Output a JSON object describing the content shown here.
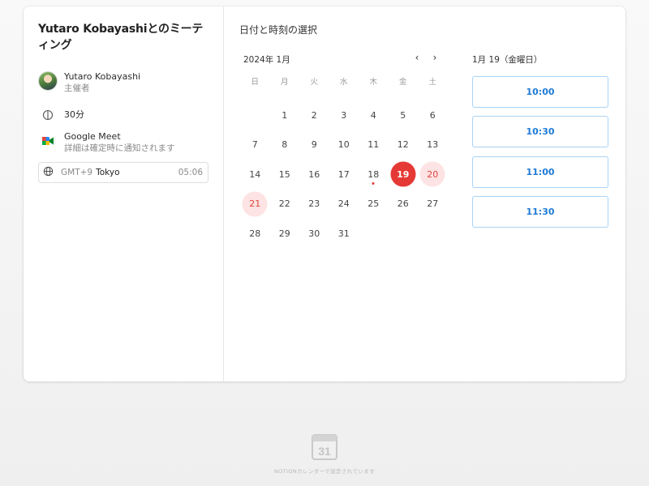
{
  "meeting": {
    "title": "Yutaro Kobayashiとのミーティング",
    "host_name": "Yutaro Kobayashi",
    "host_role": "主催者",
    "duration": "30分",
    "conference_name": "Google Meet",
    "conference_note": "詳細は確定時に通知されます",
    "timezone_offset": "GMT+9",
    "timezone_city": "Tokyo",
    "current_time": "05:06"
  },
  "calendar": {
    "section_title": "日付と時刻の選択",
    "month_label": "2024年 1月",
    "prev_label": "‹",
    "next_label": "›",
    "weekdays": [
      "日",
      "月",
      "火",
      "水",
      "木",
      "金",
      "土"
    ],
    "days": [
      "",
      "1",
      "2",
      "3",
      "4",
      "5",
      "6",
      "7",
      "8",
      "9",
      "10",
      "11",
      "12",
      "13",
      "14",
      "15",
      "16",
      "17",
      "18",
      "19",
      "20",
      "21",
      "22",
      "23",
      "24",
      "25",
      "26",
      "27",
      "28",
      "29",
      "30",
      "31"
    ],
    "selected_day": "19",
    "available_days": [
      "20",
      "21"
    ],
    "today_day": "18",
    "accent_color": "#e53935"
  },
  "timeslots": {
    "date_label": "1月 19（金曜日）",
    "slots": [
      "10:00",
      "10:30",
      "11:00",
      "11:30"
    ]
  },
  "footer": {
    "logo_number": "31",
    "text": "NOTIONカレンダーで設定されています"
  }
}
